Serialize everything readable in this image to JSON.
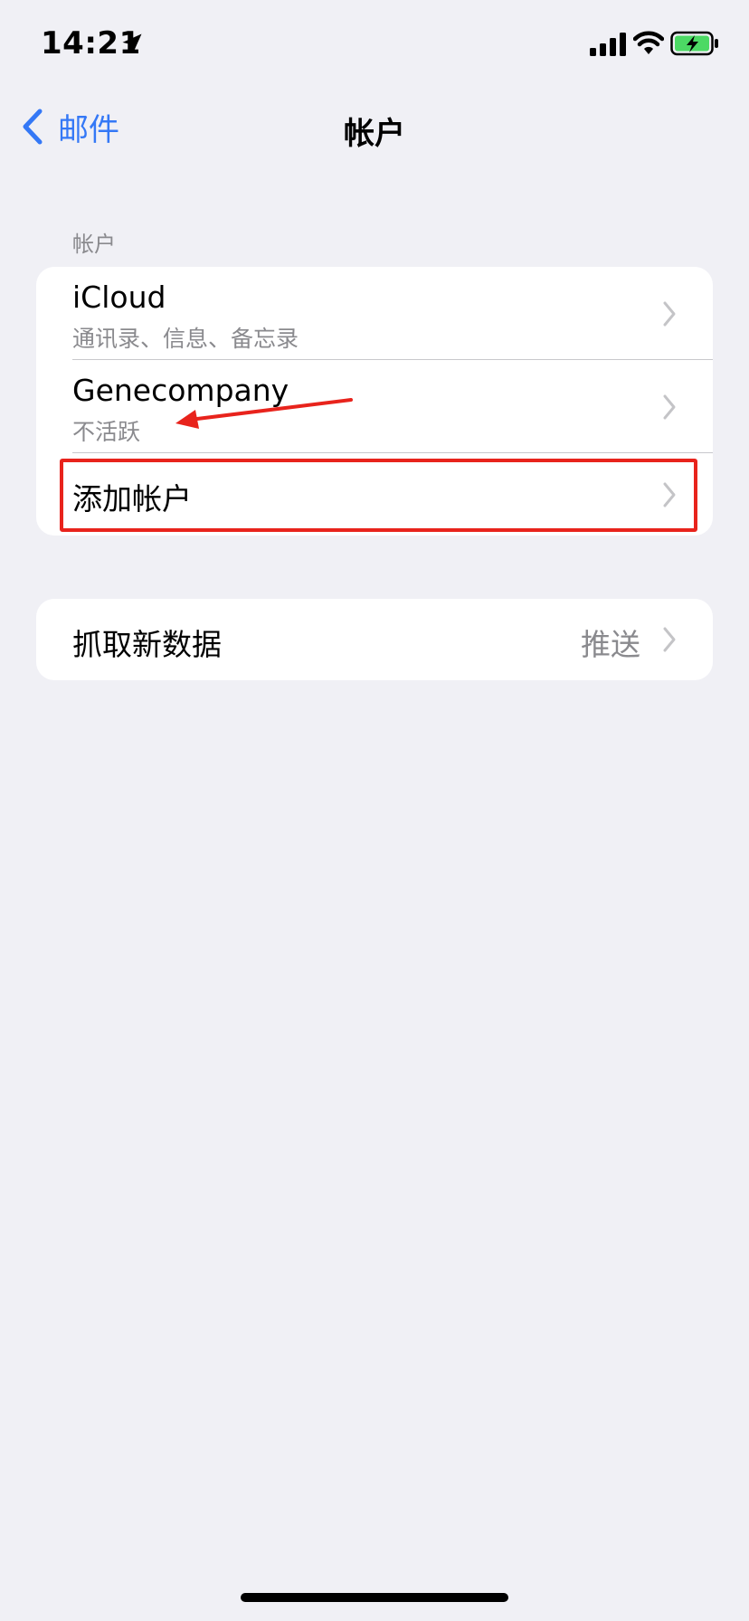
{
  "status_bar": {
    "time": "14:21",
    "icons": [
      "location-arrow-icon",
      "cellular-signal-icon",
      "wifi-icon",
      "battery-charging-icon"
    ],
    "battery_color": "#4cd964"
  },
  "nav": {
    "back_label": "邮件",
    "title": "帐户"
  },
  "accounts_section": {
    "header": "帐户",
    "rows": [
      {
        "title": "iCloud",
        "subtitle": "通讯录、信息、备忘录"
      },
      {
        "title": "Genecompany",
        "subtitle": "不活跃"
      },
      {
        "title": "添加帐户"
      }
    ]
  },
  "fetch_section": {
    "title": "抓取新数据",
    "value": "推送"
  },
  "colors": {
    "accent": "#3478f6",
    "background": "#f0f0f5",
    "annotation": "#e8231c",
    "secondary_text": "#8a8a8e"
  }
}
